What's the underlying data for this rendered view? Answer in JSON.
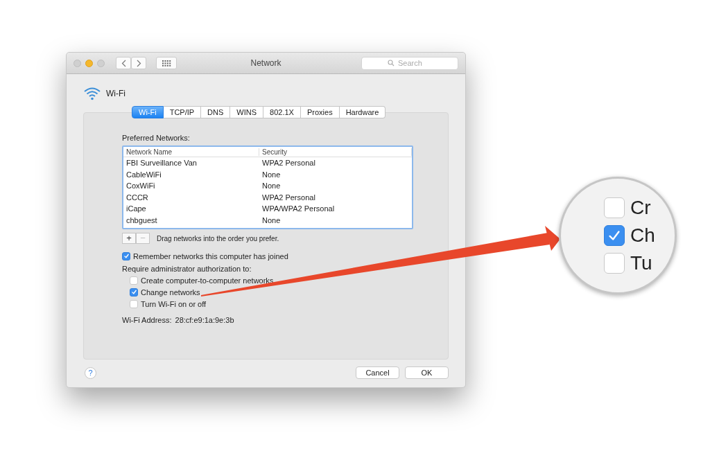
{
  "window": {
    "title": "Network",
    "search": {
      "placeholder": "Search"
    }
  },
  "header": {
    "title": "Wi-Fi"
  },
  "tabs": [
    {
      "label": "Wi-Fi",
      "selected": true
    },
    {
      "label": "TCP/IP",
      "selected": false
    },
    {
      "label": "DNS",
      "selected": false
    },
    {
      "label": "WINS",
      "selected": false
    },
    {
      "label": "802.1X",
      "selected": false
    },
    {
      "label": "Proxies",
      "selected": false
    },
    {
      "label": "Hardware",
      "selected": false
    }
  ],
  "preferred_networks": {
    "label": "Preferred Networks:",
    "columns": [
      "Network Name",
      "Security"
    ],
    "rows": [
      {
        "network_name": "FBI Surveillance Van",
        "security": "WPA2 Personal"
      },
      {
        "network_name": "CableWiFi",
        "security": "None"
      },
      {
        "network_name": "CoxWiFi",
        "security": "None"
      },
      {
        "network_name": "CCCR",
        "security": "WPA2 Personal"
      },
      {
        "network_name": "iCape",
        "security": "WPA/WPA2 Personal"
      },
      {
        "network_name": "chbguest",
        "security": "None"
      }
    ],
    "add_button": {
      "label": "+",
      "disabled": false
    },
    "remove_button": {
      "label": "−",
      "disabled": true
    },
    "hint": "Drag networks into the order you prefer."
  },
  "remember": {
    "label": "Remember networks this computer has joined",
    "checked": true
  },
  "require_label": "Require administrator authorization to:",
  "admin_options": [
    {
      "label": "Create computer-to-computer networks",
      "checked": false
    },
    {
      "label": "Change networks",
      "checked": true
    },
    {
      "label": "Turn Wi-Fi on or off",
      "checked": false
    }
  ],
  "wifi_address": {
    "label": "Wi-Fi Address:",
    "value": "28:cf:e9:1a:9e:3b"
  },
  "help_button": "?",
  "buttons": [
    {
      "label": "Cancel"
    },
    {
      "label": "OK"
    }
  ],
  "magnifier": {
    "items": [
      {
        "label": "Cr",
        "checked": false
      },
      {
        "label": "Ch",
        "checked": true
      },
      {
        "label": "Tu",
        "checked": false
      }
    ]
  }
}
